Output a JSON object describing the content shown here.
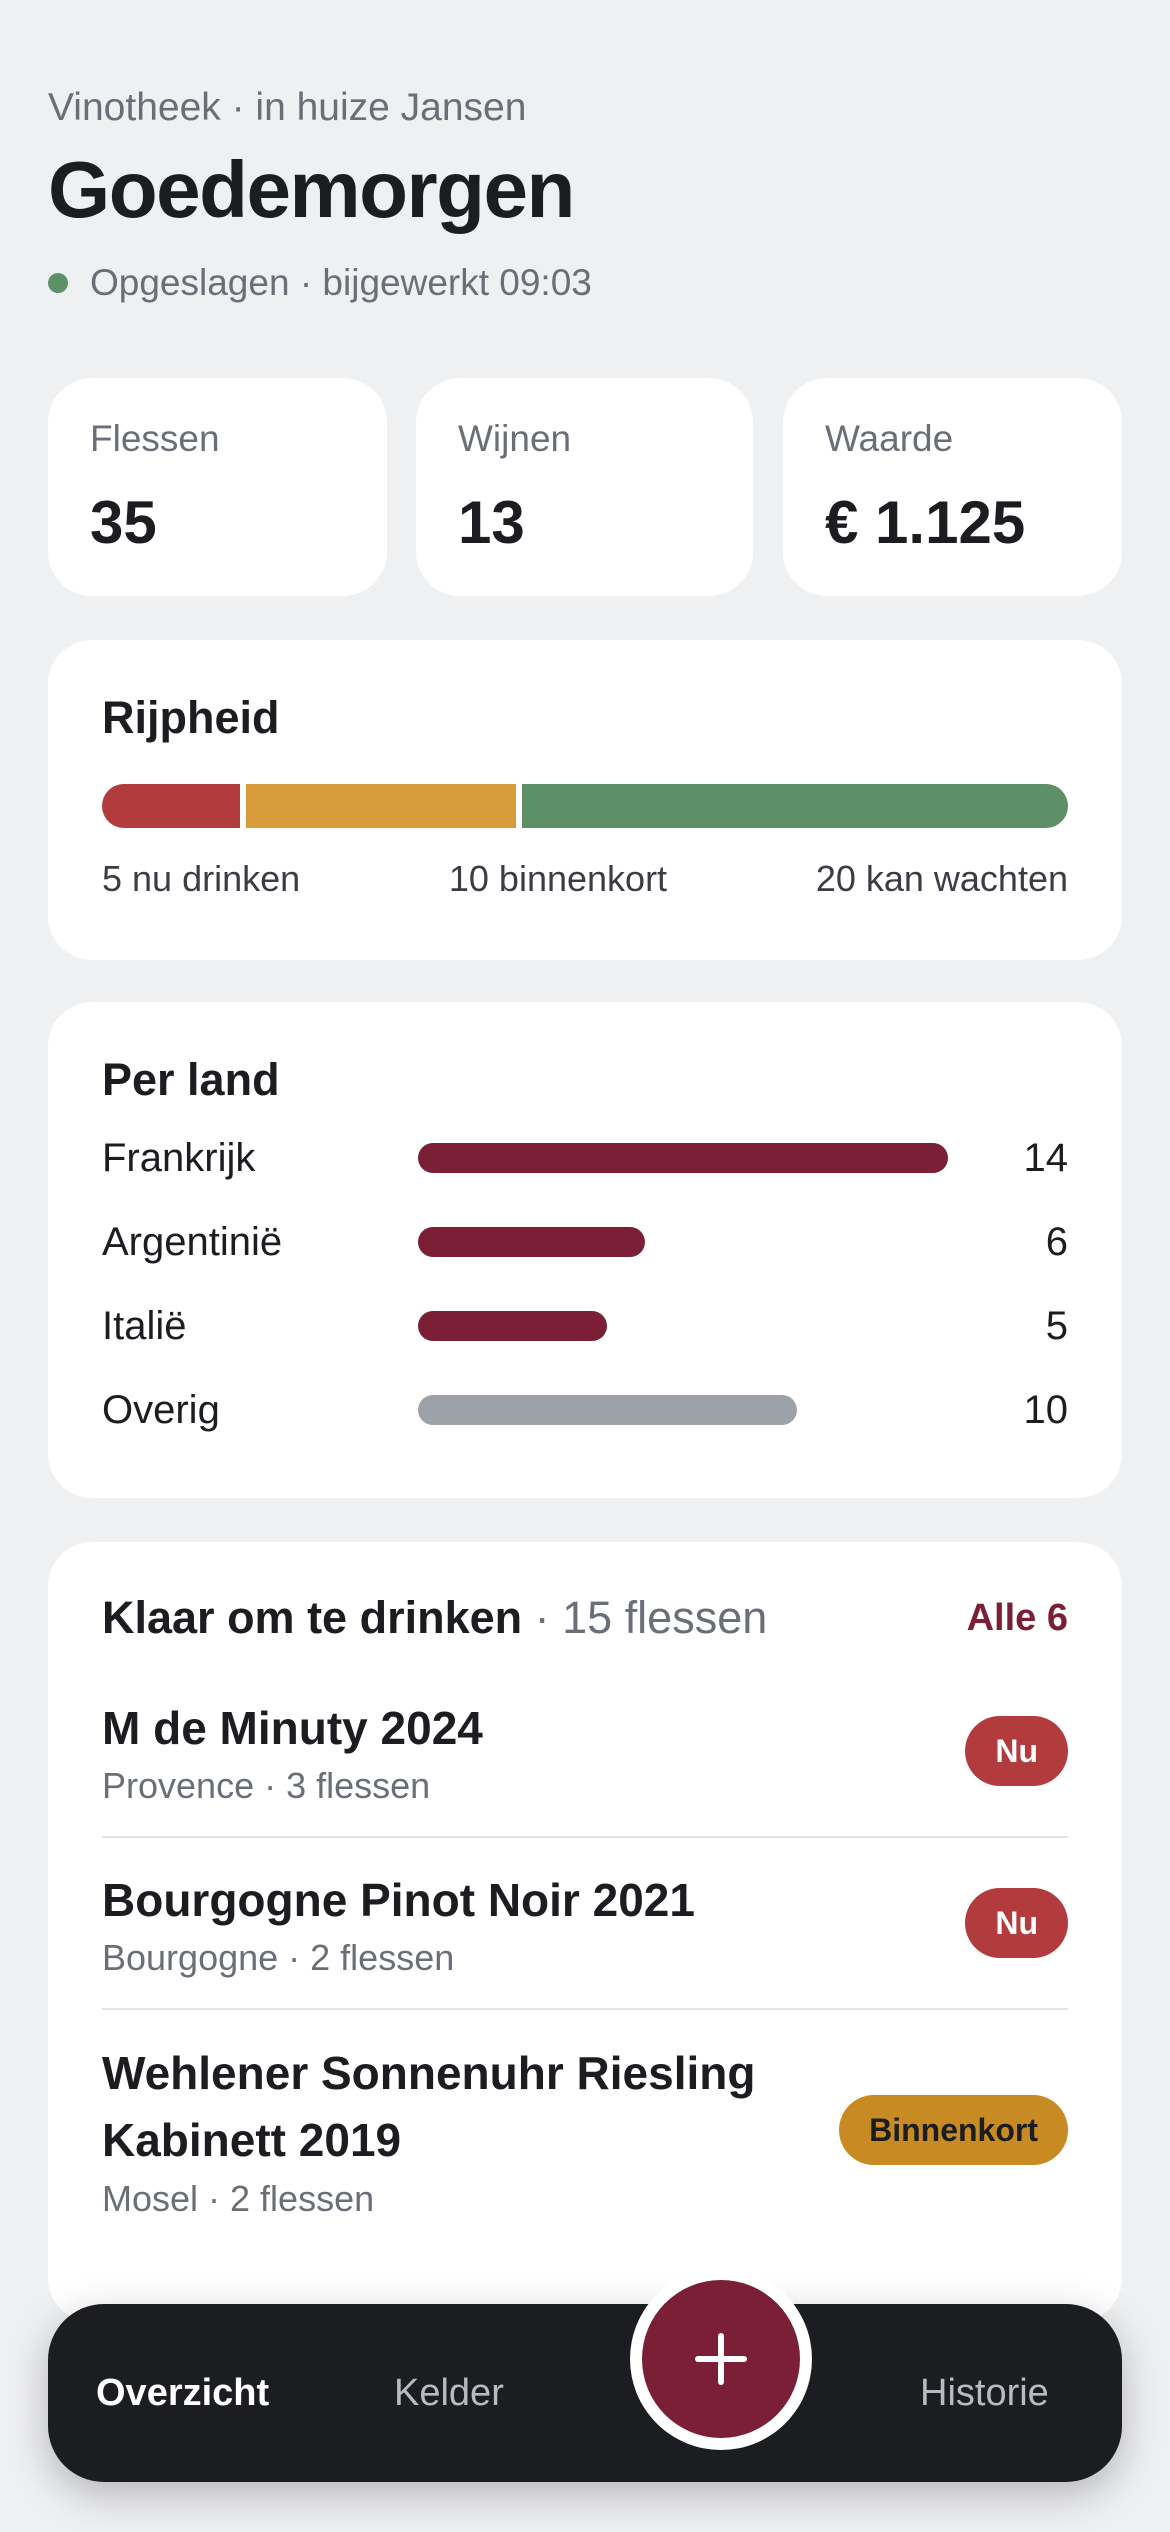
{
  "header": {
    "subtitle": "Vinotheek · in huize Jansen",
    "greeting": "Goedemorgen",
    "status": "Opgeslagen · bijgewerkt 09:03"
  },
  "stats": [
    {
      "label": "Flessen",
      "value": "35"
    },
    {
      "label": "Wijnen",
      "value": "13"
    },
    {
      "label": "Waarde",
      "value": "€ 1.125"
    }
  ],
  "ripeness": {
    "title": "Rijpheid",
    "segments": [
      {
        "label": "5 nu drinken",
        "count": 5,
        "color": "#B23B3E"
      },
      {
        "label": "10 binnenkort",
        "count": 10,
        "color": "#D89B3A"
      },
      {
        "label": "20 kan wachten",
        "count": 20,
        "color": "#5E9068"
      }
    ]
  },
  "per_country": {
    "title": "Per land",
    "max": 14,
    "rows": [
      {
        "name": "Frankrijk",
        "count": "14",
        "value": 14,
        "color": "#7A1F35"
      },
      {
        "name": "Argentinië",
        "count": "6",
        "value": 6,
        "color": "#7A1F35"
      },
      {
        "name": "Italië",
        "count": "5",
        "value": 5,
        "color": "#7A1F35"
      },
      {
        "name": "Overig",
        "count": "10",
        "value": 10,
        "color": "#9DA1A8"
      }
    ]
  },
  "ready": {
    "title": "Klaar om te drinken",
    "count_text": " · 15 flessen",
    "all_link": "Alle 6",
    "wines": [
      {
        "name": "M de Minuty 2024",
        "meta": "Provence · 3 flessen",
        "badge": "Nu",
        "badge_bg": "#B23B3E",
        "badge_fg": "#FFFFFF"
      },
      {
        "name": "Bourgogne Pinot Noir 2021",
        "meta": "Bourgogne · 2 flessen",
        "badge": "Nu",
        "badge_bg": "#B23B3E",
        "badge_fg": "#FFFFFF"
      },
      {
        "name": "Wehlener Sonnenuhr Riesling Kabinett 2019",
        "meta": "Mosel · 2 flessen",
        "badge": "Binnenkort",
        "badge_bg": "#C88A22",
        "badge_fg": "#1C1D21"
      }
    ]
  },
  "nav": {
    "overview": "Overzicht",
    "cellar": "Kelder",
    "history": "Historie",
    "add_icon": "plus-icon"
  },
  "colors": {
    "accent": "#7A1F35",
    "background": "#EFF0F2"
  }
}
